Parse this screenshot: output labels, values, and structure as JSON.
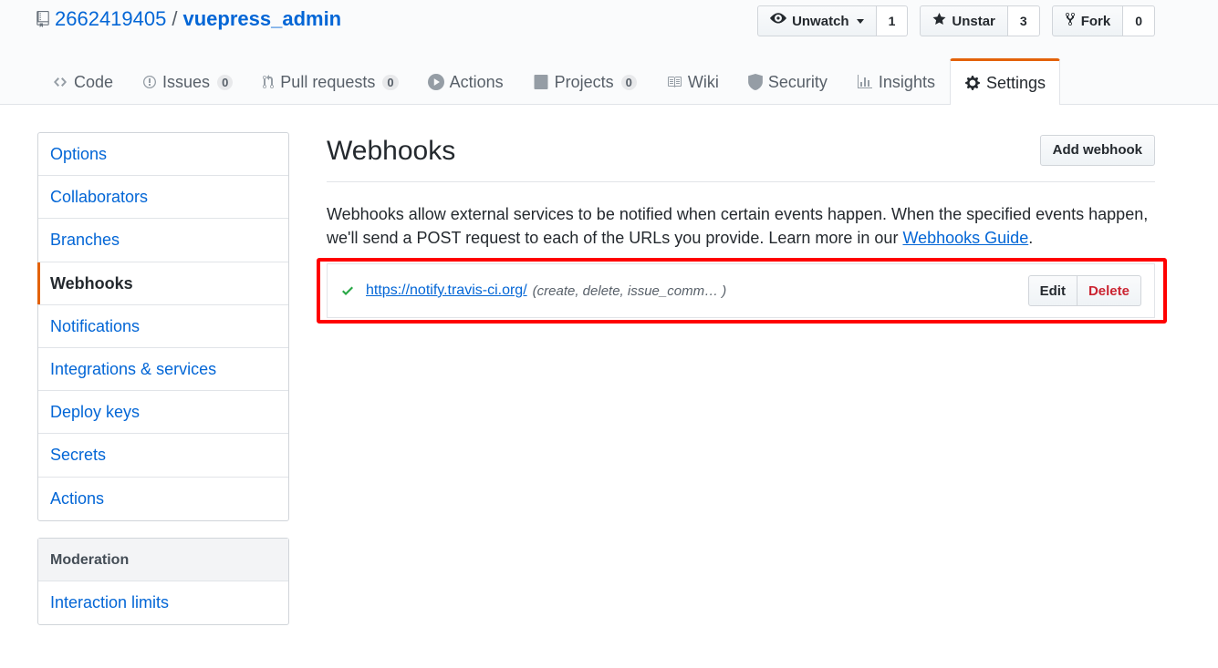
{
  "repo": {
    "owner": "2662419405",
    "separator": "/",
    "name": "vuepress_admin"
  },
  "actions": [
    {
      "label": "Unwatch",
      "count": "1",
      "icon": "eye-icon"
    },
    {
      "label": "Unstar",
      "count": "3",
      "icon": "star-icon"
    },
    {
      "label": "Fork",
      "count": "0",
      "icon": "fork-icon"
    }
  ],
  "tabs": [
    {
      "label": "Code",
      "icon": "code-icon"
    },
    {
      "label": "Issues",
      "count": "0",
      "icon": "issue-icon"
    },
    {
      "label": "Pull requests",
      "count": "0",
      "icon": "pull-request-icon"
    },
    {
      "label": "Actions",
      "icon": "play-icon"
    },
    {
      "label": "Projects",
      "count": "0",
      "icon": "project-icon"
    },
    {
      "label": "Wiki",
      "icon": "book-icon"
    },
    {
      "label": "Security",
      "icon": "shield-icon"
    },
    {
      "label": "Insights",
      "icon": "graph-icon"
    },
    {
      "label": "Settings",
      "icon": "gear-icon",
      "selected": true
    }
  ],
  "sidebar": {
    "items": [
      "Options",
      "Collaborators",
      "Branches",
      "Webhooks",
      "Notifications",
      "Integrations & services",
      "Deploy keys",
      "Secrets",
      "Actions"
    ],
    "selected": "Webhooks",
    "moderation": {
      "heading": "Moderation",
      "items": [
        "Interaction limits"
      ]
    }
  },
  "main": {
    "title": "Webhooks",
    "add_button": "Add webhook",
    "description_prefix": "Webhooks allow external services to be notified when certain events happen. When the specified events happen, we'll send a POST request to each of the URLs you provide. Learn more in our ",
    "description_link": "Webhooks Guide",
    "description_suffix": ".",
    "hook": {
      "url": "https://notify.travis-ci.org/",
      "events": "(create, delete, issue_comm… )",
      "edit_label": "Edit",
      "delete_label": "Delete"
    }
  },
  "colors": {
    "link": "#0366d6",
    "accent": "#e36209",
    "success": "#28a745",
    "danger": "#cb2431",
    "highlight": "#ff0000"
  }
}
